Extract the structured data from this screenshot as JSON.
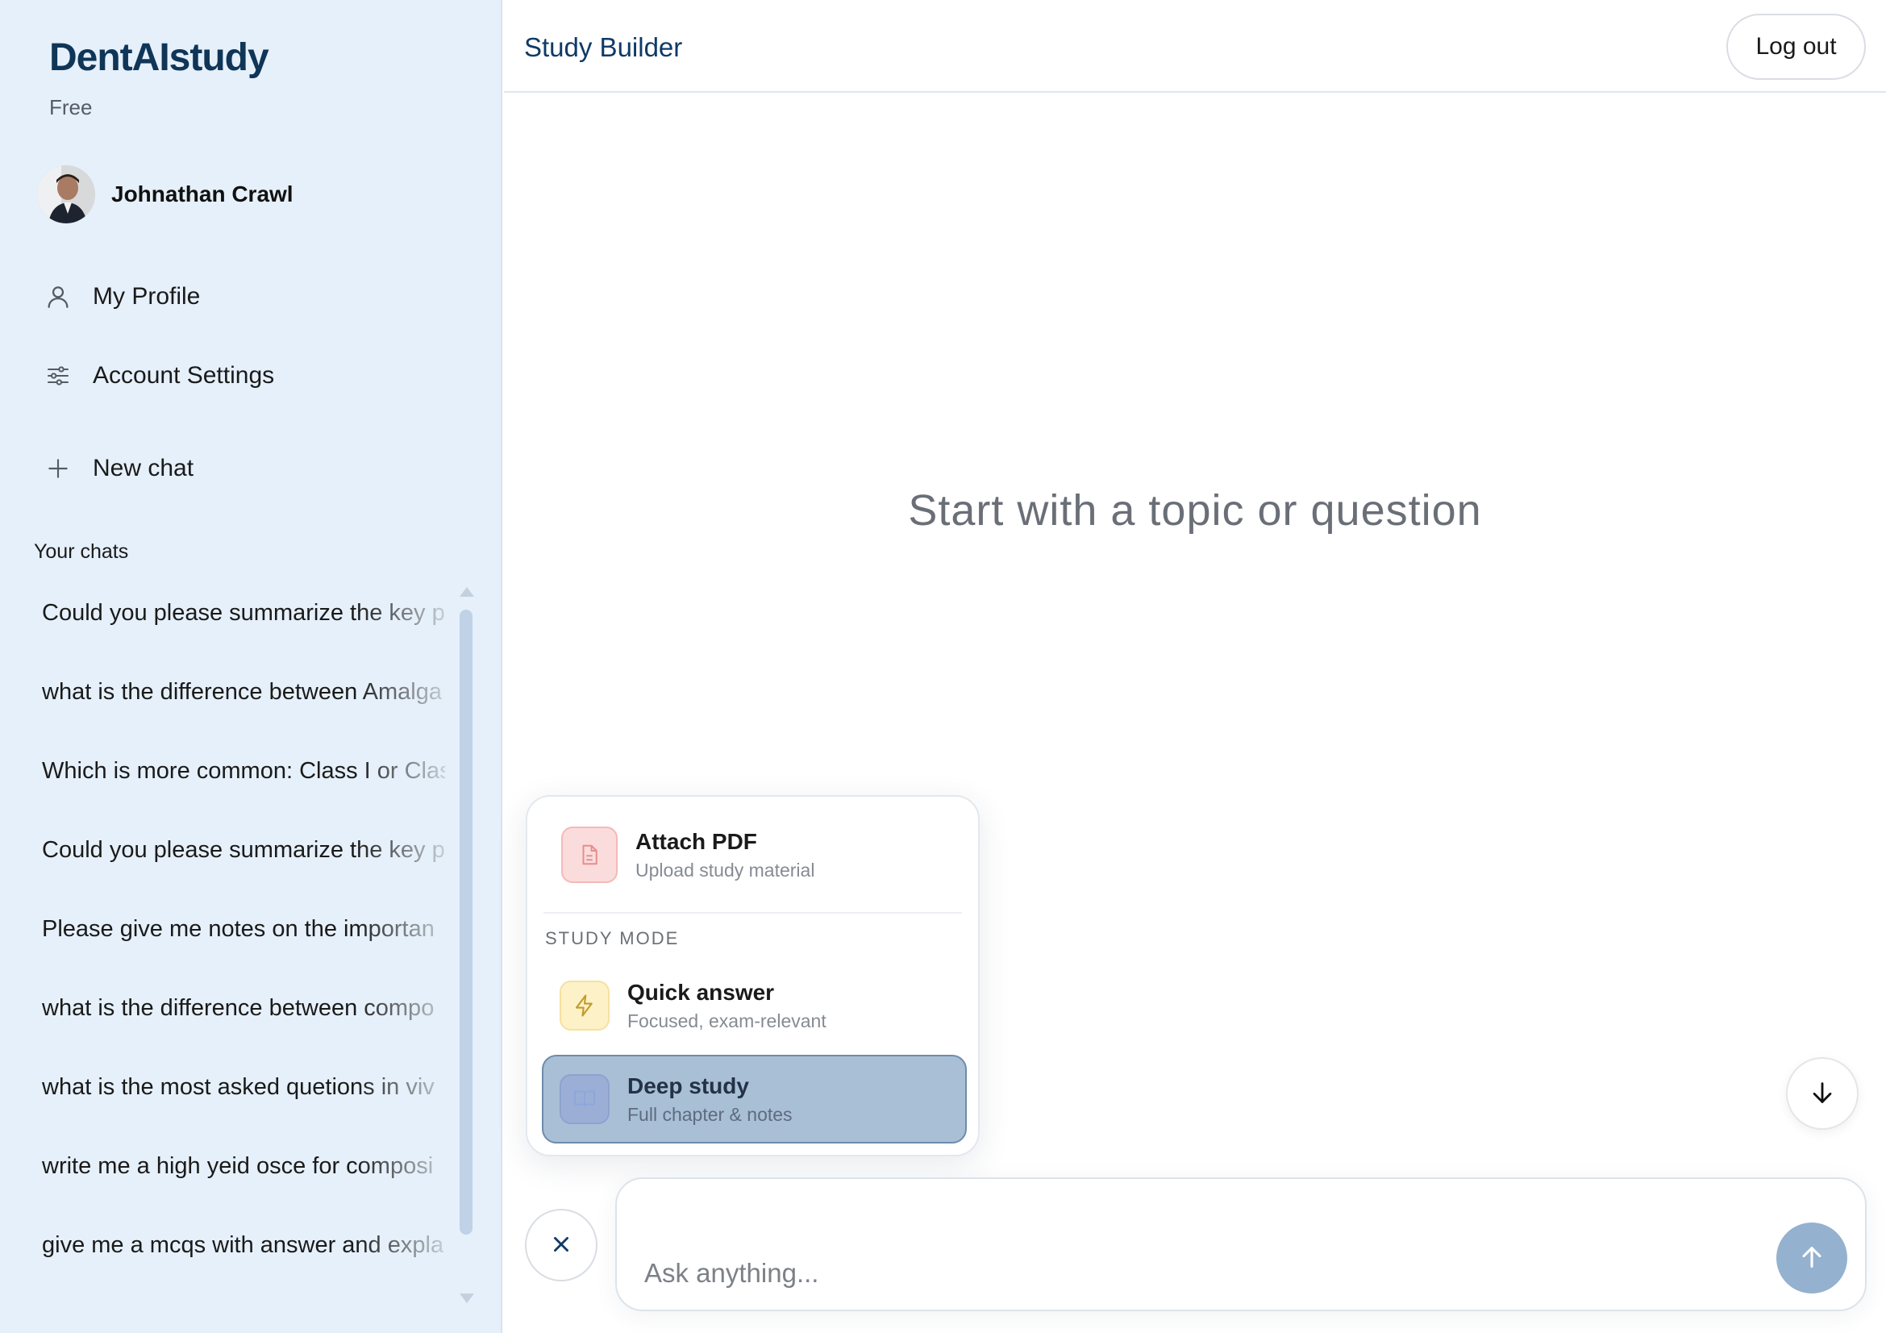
{
  "sidebar": {
    "brand": "DentAIstudy",
    "plan": "Free",
    "user": {
      "name": "Johnathan Crawl"
    },
    "nav": [
      {
        "label": "My Profile",
        "icon": "user-icon"
      },
      {
        "label": "Account Settings",
        "icon": "sliders-icon"
      },
      {
        "label": "New chat",
        "icon": "plus-icon"
      }
    ],
    "chats_title": "Your chats",
    "chats": [
      "Could you please summarize the key p",
      "what is the difference between Amalga",
      "Which is more common: Class I or Clas",
      "Could you please summarize the key p",
      "Please give me notes on the importan",
      "what is the difference between compo",
      "what is the most asked quetions in viv",
      "write me a high yeid osce for composi",
      "give me a mcqs with answer and expla"
    ]
  },
  "header": {
    "title": "Study Builder",
    "logout_label": "Log out"
  },
  "main": {
    "empty_prompt": "Start with a topic or question"
  },
  "menu": {
    "attach": {
      "title": "Attach PDF",
      "subtitle": "Upload study material",
      "icon": "file-icon"
    },
    "section_label": "STUDY MODE",
    "modes": [
      {
        "title": "Quick answer",
        "subtitle": "Focused, exam-relevant",
        "icon": "lightning-icon",
        "selected": false
      },
      {
        "title": "Deep study",
        "subtitle": "Full chapter & notes",
        "icon": "book-icon",
        "selected": true
      }
    ]
  },
  "composer": {
    "placeholder": "Ask anything..."
  },
  "colors": {
    "sidebar_bg": "#e6f0fa",
    "brand": "#0f3557",
    "accent": "#0f3a66",
    "selected_mode_bg": "#a9bfd6",
    "send_button": "#94b1cf"
  }
}
